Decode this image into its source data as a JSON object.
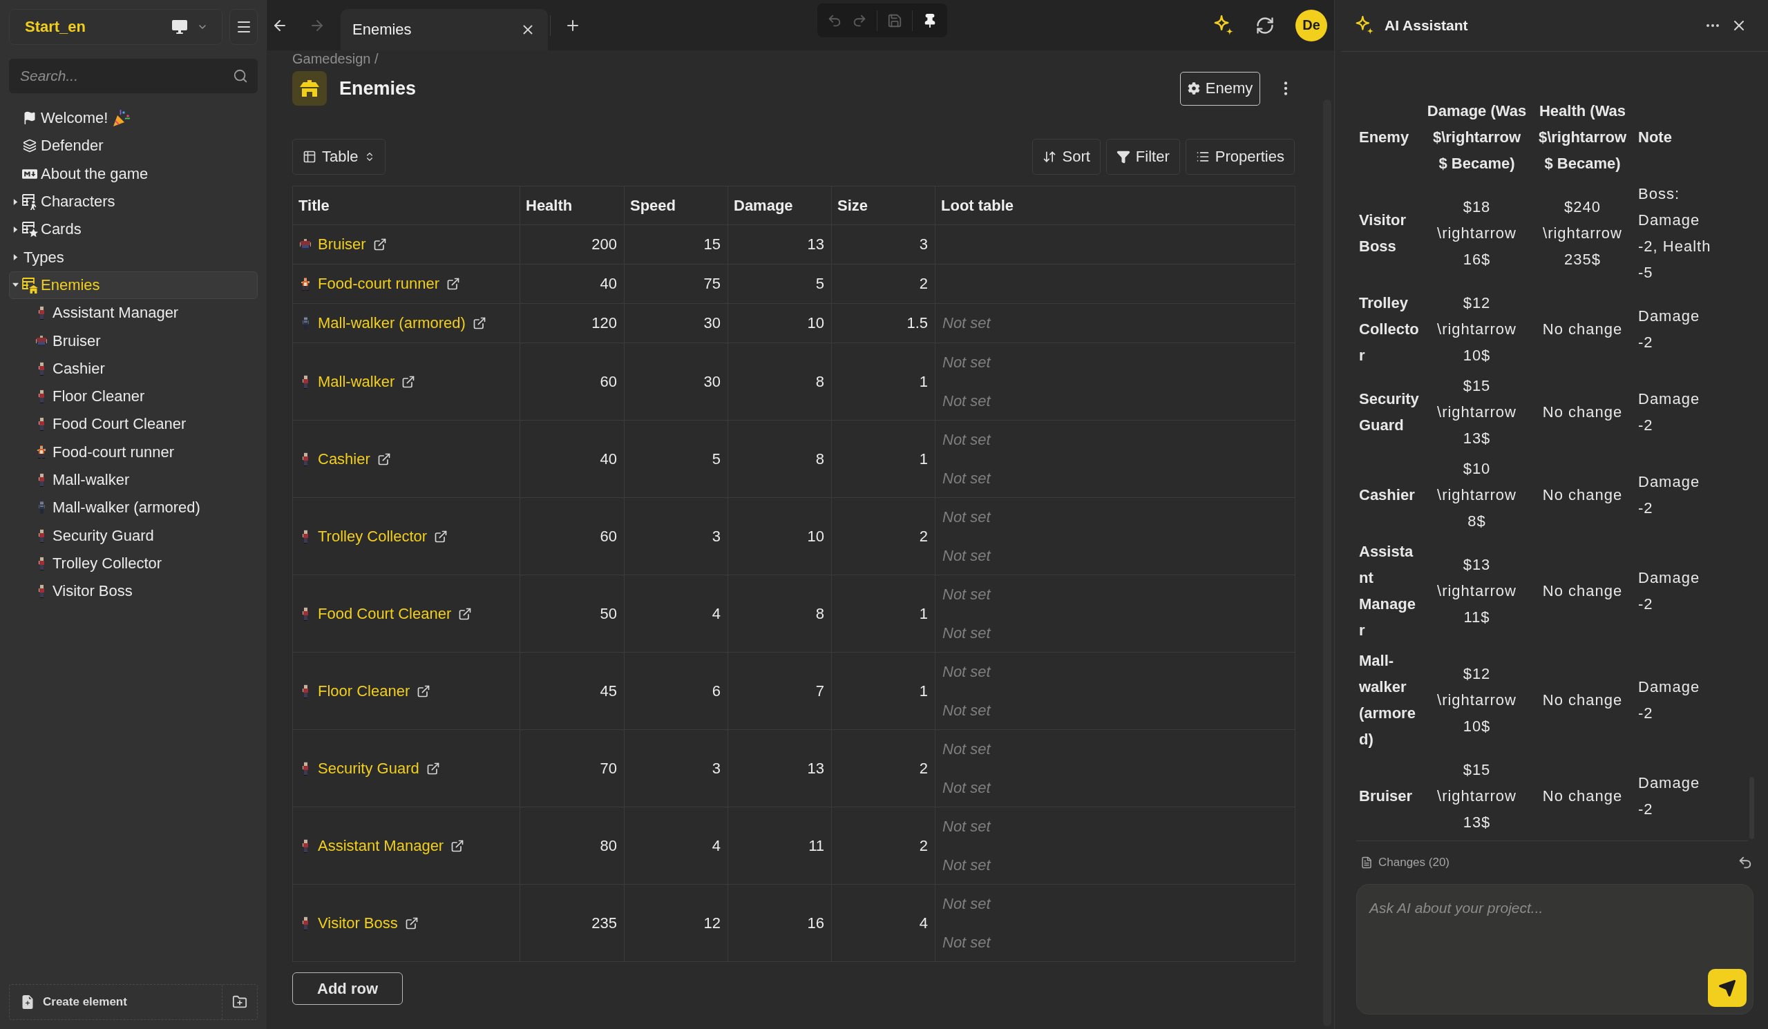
{
  "sidebar": {
    "workspace": "Start_en",
    "search": {
      "placeholder": "Search..."
    },
    "tree": [
      {
        "label": "Welcome!",
        "selected": false
      },
      {
        "label": "Defender",
        "selected": false
      },
      {
        "label": "About the game",
        "selected": false
      },
      {
        "label": "Characters",
        "expanded": false,
        "selected": false
      },
      {
        "label": "Cards",
        "expanded": false,
        "selected": false
      },
      {
        "label": "Types",
        "expanded": false,
        "selected": false
      },
      {
        "label": "Enemies",
        "expanded": true,
        "selected": true,
        "children": [
          {
            "label": "Assistant Manager",
            "kind": "walker",
            "selected": false
          },
          {
            "label": "Bruiser",
            "kind": "bruiser",
            "selected": false
          },
          {
            "label": "Cashier",
            "kind": "walker",
            "selected": false
          },
          {
            "label": "Floor Cleaner",
            "kind": "walker",
            "selected": false
          },
          {
            "label": "Food Court Cleaner",
            "kind": "walker",
            "selected": false
          },
          {
            "label": "Food-court runner",
            "kind": "runner",
            "selected": false
          },
          {
            "label": "Mall-walker",
            "kind": "walker",
            "selected": false
          },
          {
            "label": "Mall-walker (armored)",
            "kind": "armored",
            "selected": false
          },
          {
            "label": "Security Guard",
            "kind": "walker",
            "selected": false
          },
          {
            "label": "Trolley Collector",
            "kind": "walker",
            "selected": false
          },
          {
            "label": "Visitor Boss",
            "kind": "walker",
            "selected": false
          }
        ]
      }
    ],
    "create_button": "Create element"
  },
  "top_bar": {
    "back_disabled": false,
    "forward_disabled": true,
    "tabs": [
      {
        "label": "Enemies",
        "selected": true
      }
    ],
    "history_tools": [
      {
        "disabled": true
      },
      {
        "disabled": true
      },
      {
        "disabled": true
      },
      {
        "disabled": false
      }
    ],
    "avatar": "De"
  },
  "page": {
    "breadcrumb": "Gamedesign /",
    "title": "Enemies",
    "type_button": "Enemy",
    "view_button": "Table",
    "actions": [
      "Sort",
      "Filter",
      "Properties"
    ],
    "table": {
      "columns": [
        "Title",
        "Health",
        "Speed",
        "Damage",
        "Size",
        "Loot table"
      ],
      "rows": [
        {
          "title": "Bruiser",
          "kind": "bruiser",
          "health": "200",
          "speed": "15",
          "damage": "13",
          "size": "3"
        },
        {
          "title": "Food-court runner",
          "kind": "runner",
          "health": "40",
          "speed": "75",
          "damage": "5",
          "size": "2"
        },
        {
          "title": "Mall-walker (armored)",
          "kind": "armored",
          "health": "120",
          "speed": "30",
          "damage": "10",
          "size": "1.5",
          "loot": [
            "Not set"
          ]
        },
        {
          "title": "Mall-walker",
          "kind": "walker",
          "health": "60",
          "speed": "30",
          "damage": "8",
          "size": "1",
          "loot": [
            "Not set",
            "Not set"
          ]
        },
        {
          "title": "Cashier",
          "kind": "walker",
          "health": "40",
          "speed": "5",
          "damage": "8",
          "size": "1",
          "loot": [
            "Not set",
            "Not set"
          ]
        },
        {
          "title": "Trolley Collector",
          "kind": "walker",
          "health": "60",
          "speed": "3",
          "damage": "10",
          "size": "2",
          "loot": [
            "Not set",
            "Not set"
          ]
        },
        {
          "title": "Food Court Cleaner",
          "kind": "walker",
          "health": "50",
          "speed": "4",
          "damage": "8",
          "size": "1",
          "loot": [
            "Not set",
            "Not set"
          ]
        },
        {
          "title": "Floor Cleaner",
          "kind": "walker",
          "health": "45",
          "speed": "6",
          "damage": "7",
          "size": "1",
          "loot": [
            "Not set",
            "Not set"
          ]
        },
        {
          "title": "Security Guard",
          "kind": "walker",
          "health": "70",
          "speed": "3",
          "damage": "13",
          "size": "2",
          "loot": [
            "Not set",
            "Not set"
          ]
        },
        {
          "title": "Assistant Manager",
          "kind": "walker",
          "health": "80",
          "speed": "4",
          "damage": "11",
          "size": "2",
          "loot": [
            "Not set",
            "Not set"
          ]
        },
        {
          "title": "Visitor Boss",
          "kind": "walker",
          "health": "235",
          "speed": "12",
          "damage": "16",
          "size": "4",
          "loot": [
            "Not set",
            "Not set"
          ]
        }
      ]
    },
    "add_row": "Add row"
  },
  "assistant": {
    "title": "AI Assistant",
    "table": {
      "columns": [
        "Enemy",
        "Damage (Was $\\rightarrow $ Became)",
        "Health (Was $\\rightarrow $ Became)",
        "Note"
      ],
      "rows": [
        [
          "Visitor Boss",
          "$18 \\rightarrow 16$",
          "$240 \\rightarrow 235$",
          "Boss: Damage -2, Health -5"
        ],
        [
          "Trolley Collector",
          "$12 \\rightarrow 10$",
          "No change",
          "Damage -2"
        ],
        [
          "Security Guard",
          "$15 \\rightarrow 13$",
          "No change",
          "Damage -2"
        ],
        [
          "Cashier",
          "$10 \\rightarrow 8$",
          "No change",
          "Damage -2"
        ],
        [
          "Assistant Manager",
          "$13 \\rightarrow 11$",
          "No change",
          "Damage -2"
        ],
        [
          "Mall-walker (armored)",
          "$12 \\rightarrow 10$",
          "No change",
          "Damage -2"
        ],
        [
          "Bruiser",
          "$15 \\rightarrow 13$",
          "No change",
          "Damage -2"
        ]
      ]
    },
    "changes": "Changes (20)",
    "input": {
      "placeholder": "Ask AI about your project..."
    }
  }
}
